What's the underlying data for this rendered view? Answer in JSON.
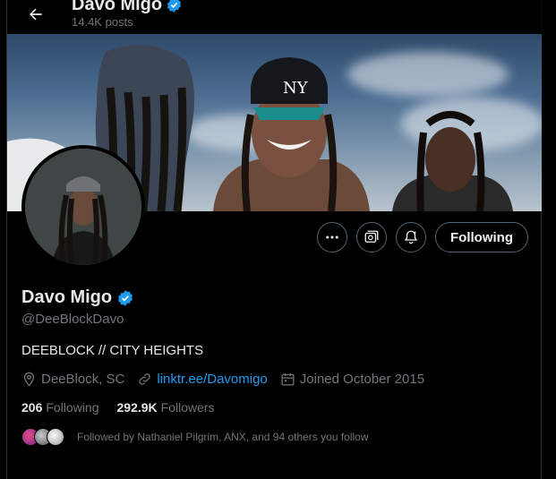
{
  "header": {
    "name": "Davo Migo",
    "posts": "14.4K posts"
  },
  "profile": {
    "name": "Davo Migo",
    "handle": "@DeeBlockDavo",
    "bio": "DEEBLOCK // CITY HEIGHTS",
    "location": "DeeBlock, SC",
    "link": "linktr.ee/Davomigo",
    "joined": "Joined October 2015",
    "following_count": "206",
    "following_label": "Following",
    "followers_count": "292.9K",
    "followers_label": "Followers",
    "followed_by": "Followed by Nathaniel Pilgrim, ANX, and 94 others you follow"
  },
  "actions": {
    "follow_label": "Following"
  },
  "colors": {
    "accent": "#1d9bf0",
    "muted": "#71767b",
    "text": "#e7e9ea",
    "verified": "#1d9bf0"
  },
  "icons": [
    "back-arrow-icon",
    "verified-badge-icon",
    "more-icon",
    "subscribe-icon",
    "notification-bell-icon",
    "location-icon",
    "link-icon",
    "calendar-icon"
  ]
}
